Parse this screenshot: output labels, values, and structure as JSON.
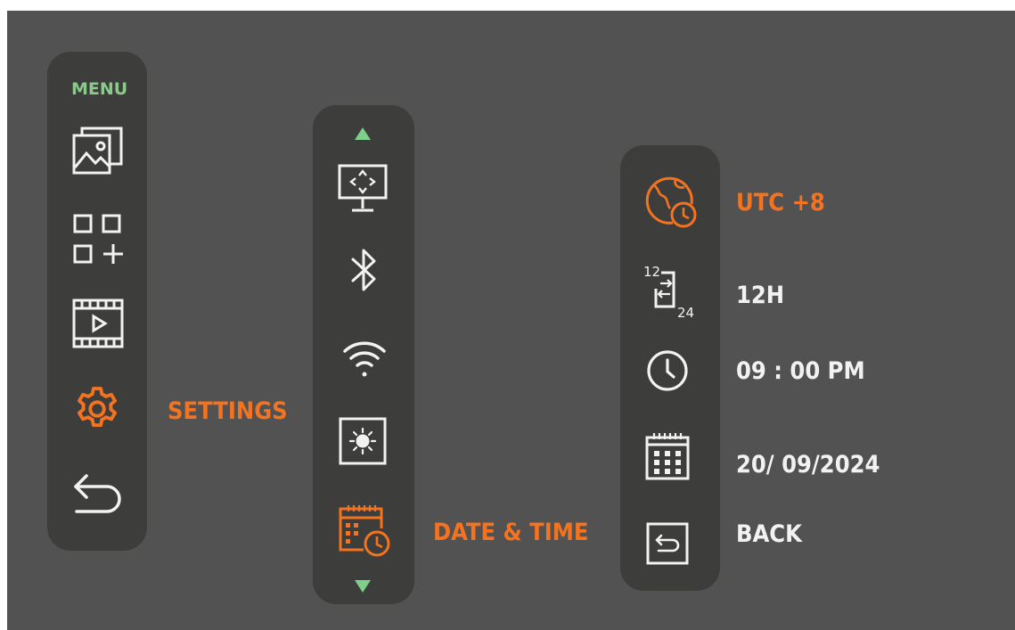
{
  "colors": {
    "accent": "#f37320",
    "menu_title": "#8cc98c",
    "arrow": "#7dcf8a",
    "icon": "#f2f2f2",
    "panel": "#3d3e3c",
    "screen": "#525252"
  },
  "menu": {
    "title": "MENU",
    "items": [
      {
        "icon": "gallery-icon"
      },
      {
        "icon": "apps-add-icon"
      },
      {
        "icon": "video-icon"
      },
      {
        "icon": "settings-gear-icon",
        "label": "SETTINGS",
        "selected": true
      },
      {
        "icon": "back-arrow-icon"
      }
    ]
  },
  "settings": {
    "items": [
      {
        "icon": "display-position-icon"
      },
      {
        "icon": "bluetooth-icon"
      },
      {
        "icon": "wifi-icon"
      },
      {
        "icon": "brightness-icon"
      },
      {
        "icon": "date-time-icon",
        "label": "DATE & TIME",
        "selected": true
      }
    ]
  },
  "datetime": {
    "timezone": "UTC +8",
    "time_format": "12H",
    "time": "09 : 00 PM",
    "date": "20/ 09/2024",
    "back": "BACK"
  }
}
